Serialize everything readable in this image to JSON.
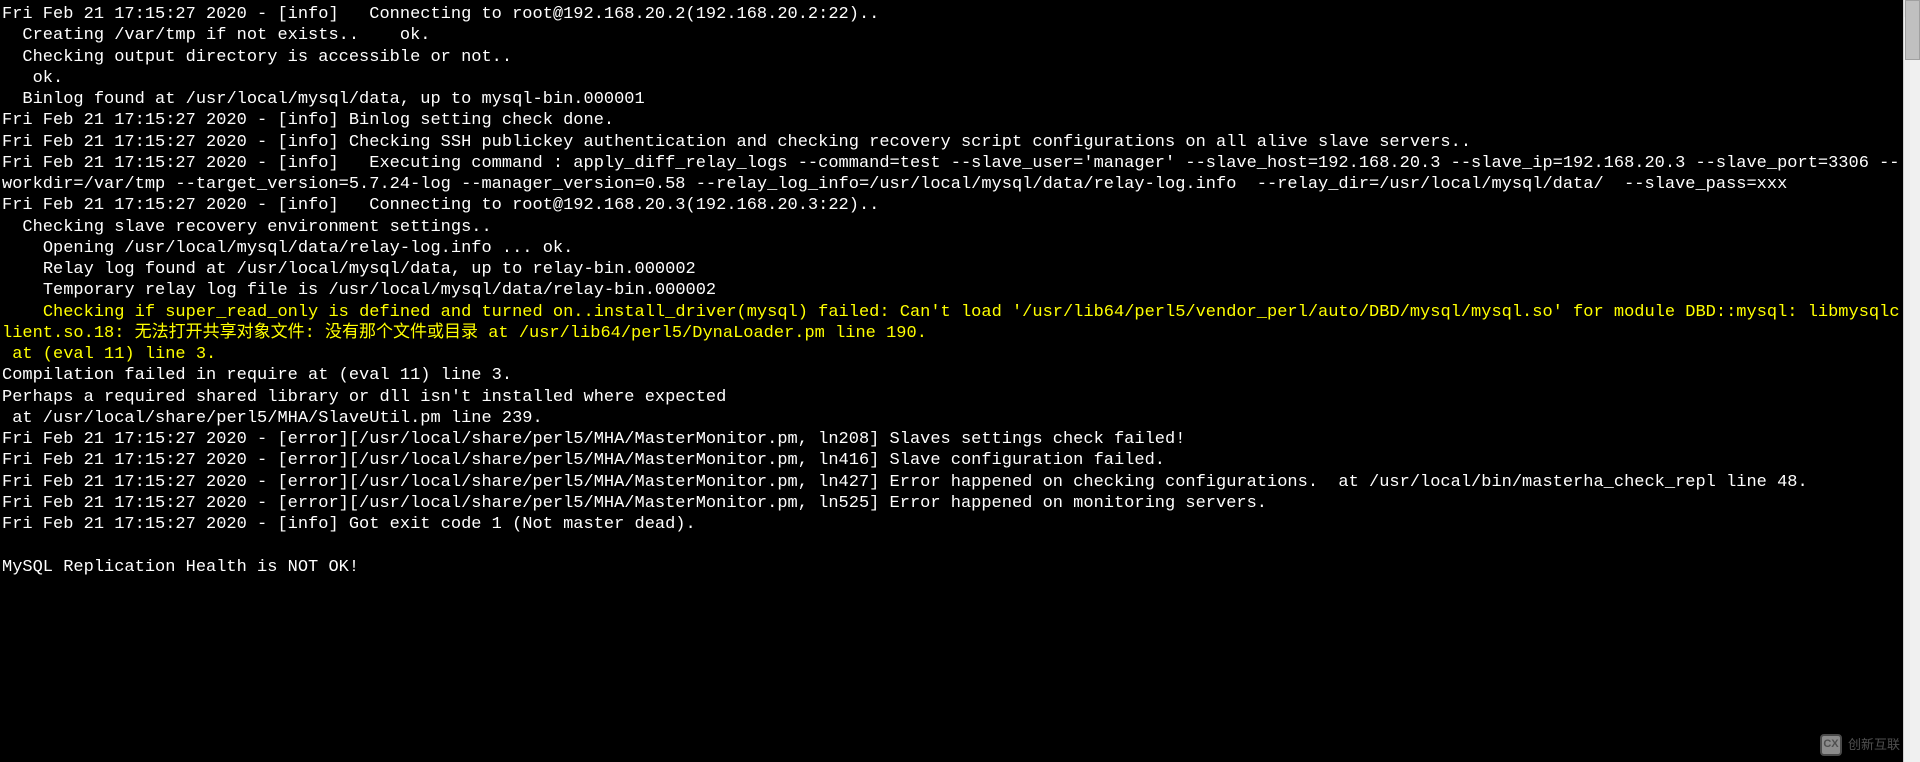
{
  "terminal": {
    "lines": [
      {
        "text": "Fri Feb 21 17:15:27 2020 - [info]   Connecting to root@192.168.20.2(192.168.20.2:22)..",
        "cls": "log-line"
      },
      {
        "text": "  Creating /var/tmp if not exists..    ok.",
        "cls": "log-line"
      },
      {
        "text": "  Checking output directory is accessible or not..",
        "cls": "log-line"
      },
      {
        "text": "   ok.",
        "cls": "log-line"
      },
      {
        "text": "  Binlog found at /usr/local/mysql/data, up to mysql-bin.000001",
        "cls": "log-line"
      },
      {
        "text": "Fri Feb 21 17:15:27 2020 - [info] Binlog setting check done.",
        "cls": "log-line"
      },
      {
        "text": "Fri Feb 21 17:15:27 2020 - [info] Checking SSH publickey authentication and checking recovery script configurations on all alive slave servers..",
        "cls": "log-line"
      },
      {
        "text": "Fri Feb 21 17:15:27 2020 - [info]   Executing command : apply_diff_relay_logs --command=test --slave_user='manager' --slave_host=192.168.20.3 --slave_ip=192.168.20.3 --slave_port=3306 --workdir=/var/tmp --target_version=5.7.24-log --manager_version=0.58 --relay_log_info=/usr/local/mysql/data/relay-log.info  --relay_dir=/usr/local/mysql/data/  --slave_pass=xxx",
        "cls": "log-line"
      },
      {
        "text": "Fri Feb 21 17:15:27 2020 - [info]   Connecting to root@192.168.20.3(192.168.20.3:22)..",
        "cls": "log-line"
      },
      {
        "text": "  Checking slave recovery environment settings..",
        "cls": "log-line"
      },
      {
        "text": "    Opening /usr/local/mysql/data/relay-log.info ... ok.",
        "cls": "log-line"
      },
      {
        "text": "    Relay log found at /usr/local/mysql/data, up to relay-bin.000002",
        "cls": "log-line"
      },
      {
        "text": "    Temporary relay log file is /usr/local/mysql/data/relay-bin.000002",
        "cls": "log-line"
      },
      {
        "text": "    Checking if super_read_only is defined and turned on..install_driver(mysql) failed: Can't load '/usr/lib64/perl5/vendor_perl/auto/DBD/mysql/mysql.so' for module DBD::mysql: libmysqlclient.so.18: 无法打开共享对象文件: 没有那个文件或目录 at /usr/lib64/perl5/DynaLoader.pm line 190.",
        "cls": "highlight"
      },
      {
        "text": " at (eval 11) line 3.",
        "cls": "highlight"
      },
      {
        "text": "Compilation failed in require at (eval 11) line 3.",
        "cls": "log-line"
      },
      {
        "text": "Perhaps a required shared library or dll isn't installed where expected",
        "cls": "log-line"
      },
      {
        "text": " at /usr/local/share/perl5/MHA/SlaveUtil.pm line 239.",
        "cls": "log-line"
      },
      {
        "text": "Fri Feb 21 17:15:27 2020 - [error][/usr/local/share/perl5/MHA/MasterMonitor.pm, ln208] Slaves settings check failed!",
        "cls": "log-line"
      },
      {
        "text": "Fri Feb 21 17:15:27 2020 - [error][/usr/local/share/perl5/MHA/MasterMonitor.pm, ln416] Slave configuration failed.",
        "cls": "log-line"
      },
      {
        "text": "Fri Feb 21 17:15:27 2020 - [error][/usr/local/share/perl5/MHA/MasterMonitor.pm, ln427] Error happened on checking configurations.  at /usr/local/bin/masterha_check_repl line 48.",
        "cls": "log-line"
      },
      {
        "text": "Fri Feb 21 17:15:27 2020 - [error][/usr/local/share/perl5/MHA/MasterMonitor.pm, ln525] Error happened on monitoring servers.",
        "cls": "log-line"
      },
      {
        "text": "Fri Feb 21 17:15:27 2020 - [info] Got exit code 1 (Not master dead).",
        "cls": "log-line"
      },
      {
        "text": "",
        "cls": "log-line"
      },
      {
        "text": "MySQL Replication Health is NOT OK!",
        "cls": "log-line"
      }
    ]
  },
  "watermark": {
    "icon_text": "CX",
    "label": "创新互联"
  },
  "scrollbar": {
    "arrow_up": "▴"
  }
}
